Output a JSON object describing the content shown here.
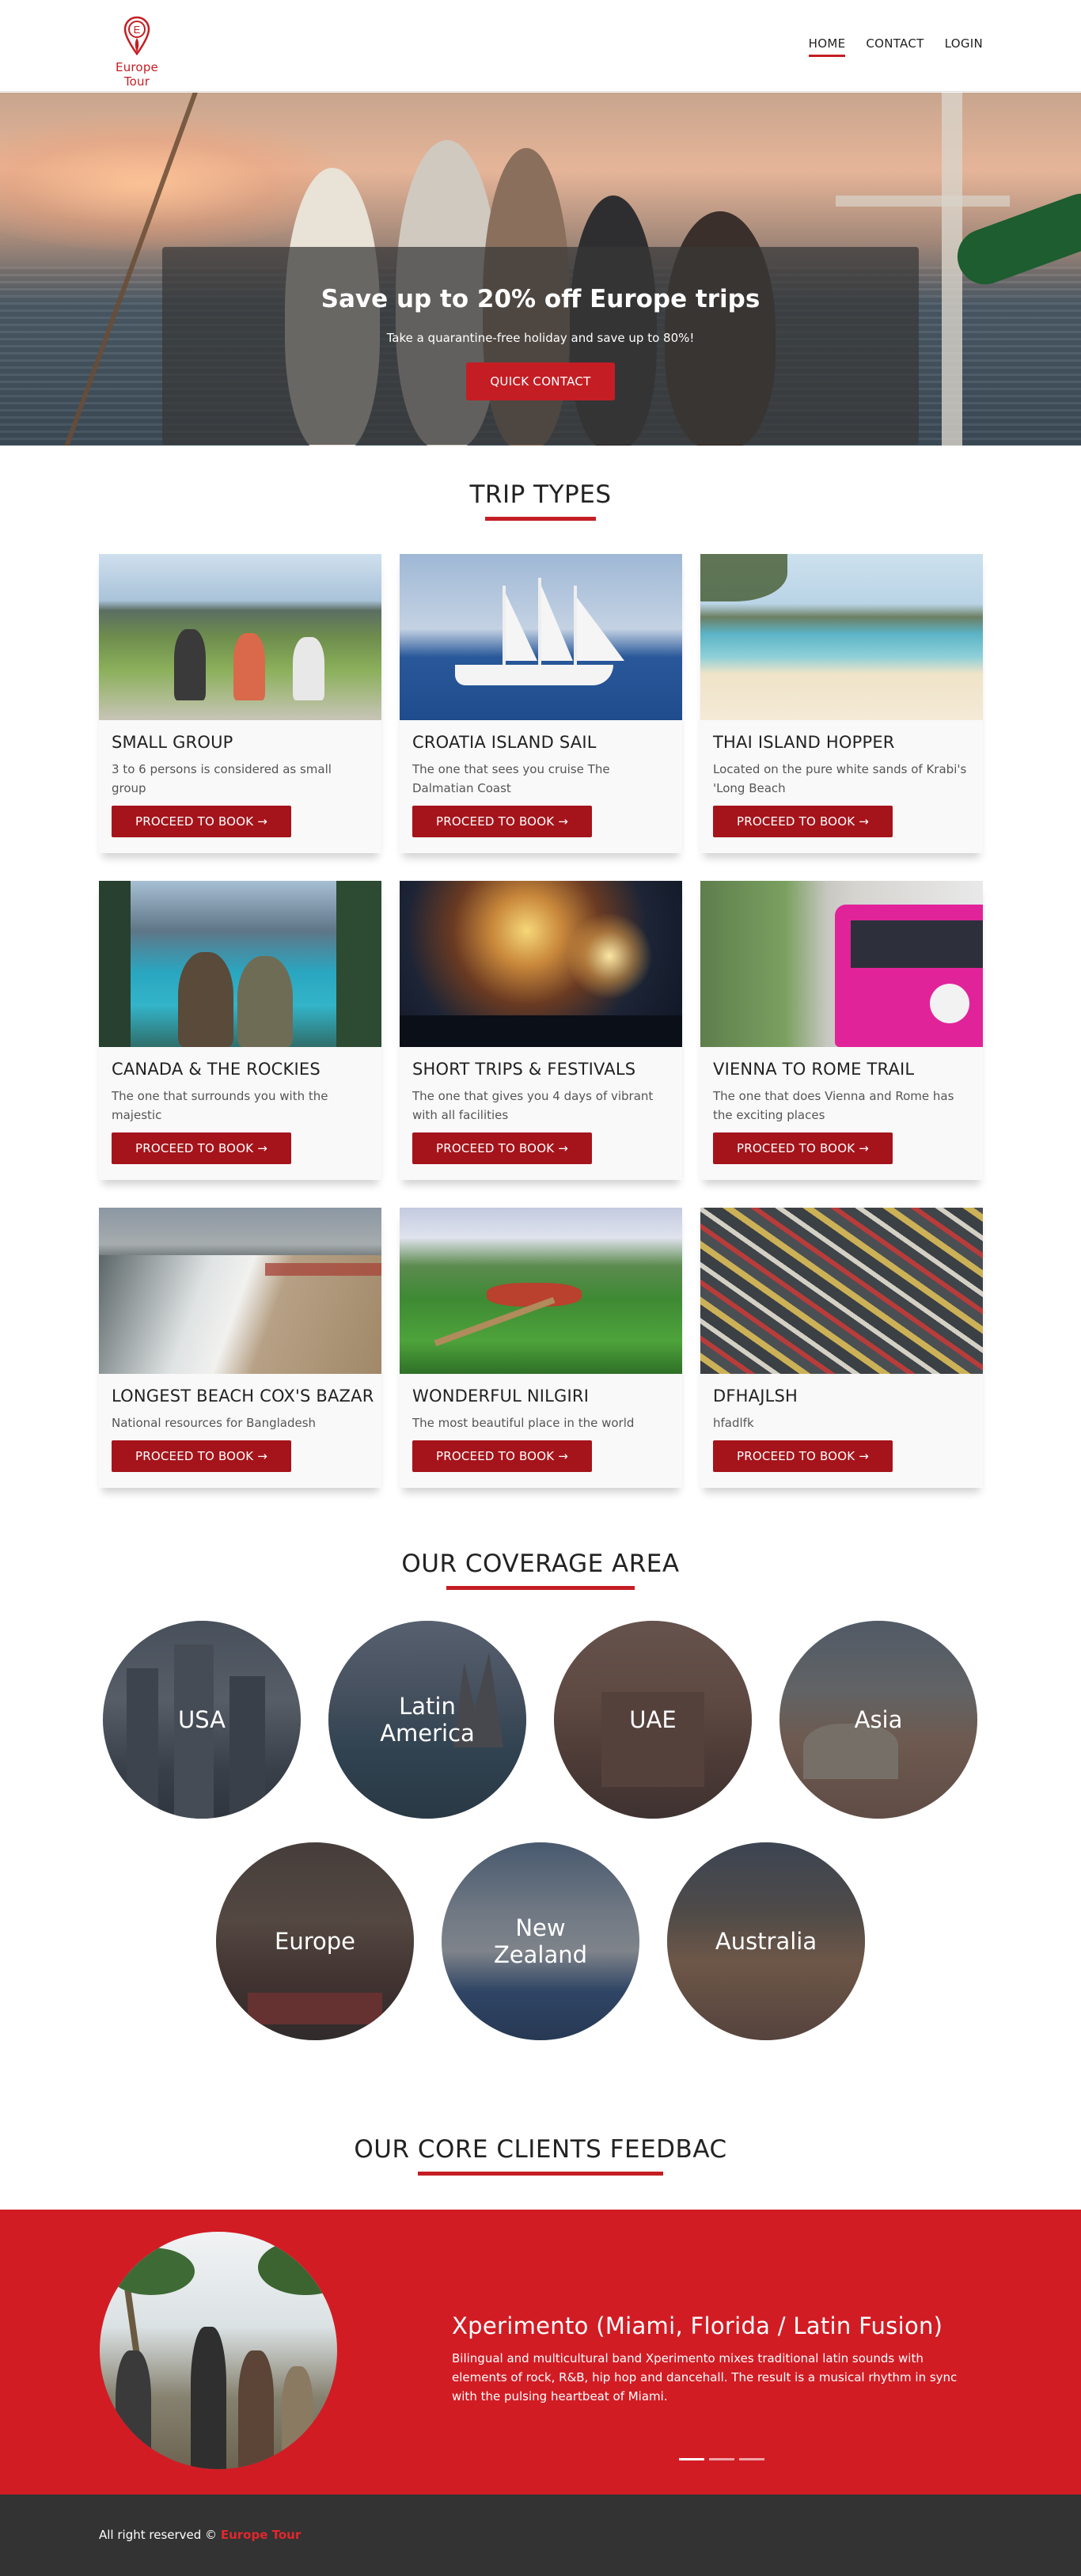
{
  "header": {
    "logo_letter": "E",
    "logo_text": "Europe Tour",
    "nav": [
      "HOME",
      "CONTACT",
      "LOGIN"
    ]
  },
  "hero": {
    "title": "Save up to 20% off Europe trips",
    "subtitle": "Take a quarantine-free holiday and save up to 80%!",
    "button": "QUICK CONTACT"
  },
  "trips": {
    "title": "TRIP TYPES",
    "button_label": "PROCEED TO BOOK →",
    "items": [
      {
        "name": "SMALL GROUP",
        "desc": "3 to 6 persons is considered as small group"
      },
      {
        "name": "CROATIA ISLAND SAIL",
        "desc": "The one that sees you cruise The Dalmatian Coast"
      },
      {
        "name": "THAI ISLAND HOPPER",
        "desc": "Located on the pure white sands of Krabi's 'Long Beach"
      },
      {
        "name": "CANADA & THE ROCKIES",
        "desc": "The one that surrounds you with the majestic"
      },
      {
        "name": "SHORT TRIPS & FESTIVALS",
        "desc": "The one that gives you 4 days of vibrant with all facilities"
      },
      {
        "name": "VIENNA TO ROME TRAIL",
        "desc": "The one that does Vienna and Rome has the exciting places"
      },
      {
        "name": "LONGEST BEACH COX'S BAZAR",
        "desc": "National resources for Bangladesh"
      },
      {
        "name": "WONDERFUL NILGIRI",
        "desc": "The most beautiful place in the world"
      },
      {
        "name": "DFHAJLSH",
        "desc": "hfadlfk"
      }
    ]
  },
  "coverage": {
    "title": "OUR COVERAGE AREA",
    "areas": [
      "USA",
      "Latin America",
      "UAE",
      "Asia",
      "Europe",
      "New Zealand",
      "Australia"
    ]
  },
  "feedback": {
    "title": "OUR CORE CLIENTS FEEDBAC",
    "name": "Xperimento (Miami, Florida / Latin Fusion)",
    "text": "Bilingual and multicultural band Xperimento mixes traditional latin sounds with elements of rock, R&B, hip hop and dancehall. The result is a musical rhythm in sync with the pulsing heartbeat of Miami."
  },
  "footer": {
    "text": "All right reserved ©",
    "brand": "Europe Tour"
  },
  "colors": {
    "accent": "#c41e24",
    "button": "#a5141b",
    "testimonial_bg": "#d21c24",
    "footer_bg": "#333333"
  }
}
